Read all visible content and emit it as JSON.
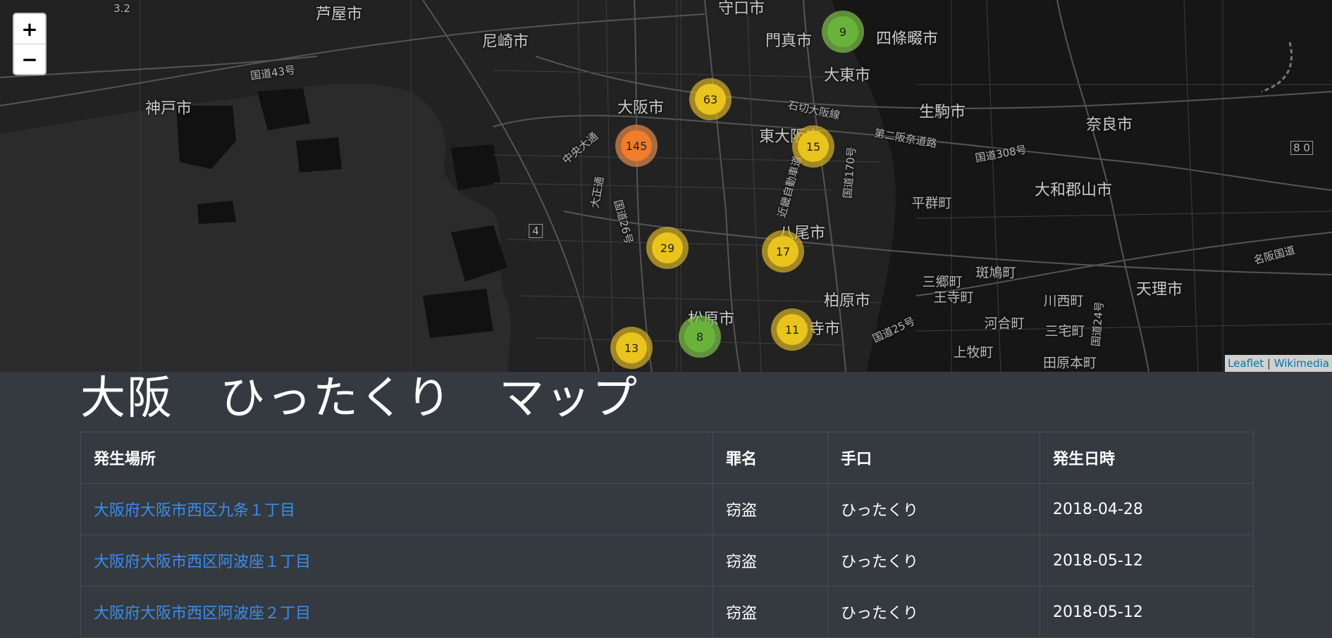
{
  "map": {
    "zoom_in": "+",
    "zoom_out": "−",
    "attribution": {
      "leaflet": "Leaflet",
      "separator": " | ",
      "tiles": "Wikimedia"
    },
    "places": {
      "ashiya": "芦屋市",
      "amagasaki": "尼崎市",
      "moriguchi": "守口市",
      "kadoma": "門真市",
      "shijonawate": "四條畷市",
      "daito": "大東市",
      "kobe": "神戸市",
      "osaka": "大阪市",
      "higashiosaka": "東大阪市",
      "ikoma": "生駒市",
      "nara": "奈良市",
      "yao": "八尾市",
      "heguri": "平群町",
      "yamatokoriyama": "大和郡山市",
      "kashiwara": "柏原市",
      "matsubara": "松原市",
      "fujiidera": "藤井寺市",
      "sango": "三郷町",
      "ikaruga": "斑鳩町",
      "kawanishi": "川西町",
      "oji": "王寺町",
      "tenri": "天理市",
      "kawai": "河合町",
      "miyake": "三宅町",
      "kanmaki": "上牧町",
      "tawaramoto": "田原本町"
    },
    "roads": {
      "r43": "国道43号",
      "ishikiri": "石切大阪線",
      "daini_hanna": "第二阪奈道路",
      "r308": "国道308号",
      "kinki": "近畿自動車道",
      "r170": "国道170号",
      "r26": "国道26号",
      "r25": "国道25号",
      "r24": "国道24号",
      "chuo": "中央大通",
      "taisho": "大正通",
      "meihan": "名阪国道",
      "route_4": "4",
      "route_32": "3.2",
      "route_80": "8 0"
    },
    "clusters": [
      {
        "count": "9",
        "level": "low"
      },
      {
        "count": "63",
        "level": "mid"
      },
      {
        "count": "145",
        "level": "high"
      },
      {
        "count": "15",
        "level": "mid"
      },
      {
        "count": "29",
        "level": "mid"
      },
      {
        "count": "17",
        "level": "mid"
      },
      {
        "count": "11",
        "level": "mid"
      },
      {
        "count": "8",
        "level": "low"
      },
      {
        "count": "13",
        "level": "mid"
      }
    ],
    "cluster_colors": {
      "low": {
        "ring": "#7ec24a",
        "core": "#6ab33a"
      },
      "mid": {
        "ring": "#d8b22a",
        "core": "#e9c41c"
      },
      "high": {
        "ring": "#e5894a",
        "core": "#ef7d2c"
      }
    }
  },
  "page_title": "大阪　ひったくり　マップ",
  "table": {
    "headers": [
      "発生場所",
      "罪名",
      "手口",
      "発生日時"
    ],
    "rows": [
      {
        "place": "大阪府大阪市西区九条１丁目",
        "crime": "窃盗",
        "method": "ひったくり",
        "date": "2018-04-28"
      },
      {
        "place": "大阪府大阪市西区阿波座１丁目",
        "crime": "窃盗",
        "method": "ひったくり",
        "date": "2018-05-12"
      },
      {
        "place": "大阪府大阪市西区阿波座２丁目",
        "crime": "窃盗",
        "method": "ひったくり",
        "date": "2018-05-12"
      }
    ]
  }
}
